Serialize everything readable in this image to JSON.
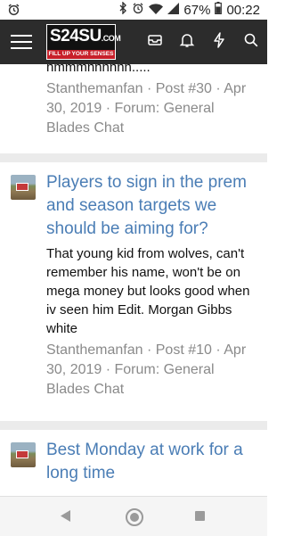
{
  "status_bar": {
    "battery": "67%",
    "time": "00:22",
    "icons": [
      "alarm-icon",
      "bluetooth-icon",
      "alarm-icon",
      "wifi-icon",
      "signal-icon",
      "battery-icon"
    ]
  },
  "app_bar": {
    "logo_text": "S24SU",
    "logo_suffix": ".COM",
    "logo_tagline": "FILL UP YOUR SENSES",
    "icons": [
      "menu-icon",
      "inbox-icon",
      "bell-icon",
      "bolt-icon",
      "search-icon"
    ]
  },
  "results": [
    {
      "snippet_tail": "hmmmnnnnnn.....",
      "author": "Stanthemanfan",
      "post": "Post #30",
      "date": "Apr 30, 2019",
      "forum": "Forum: General Blades Chat"
    },
    {
      "title": "Players to sign in the prem and season targets we should be aiming for?",
      "snippet": "That young kid from wolves, can't remember his name, won't be on mega money but looks good when iv seen him Edit. Morgan Gibbs white",
      "author": "Stanthemanfan",
      "post": "Post #10",
      "date": "Apr 30, 2019",
      "forum": "Forum: General Blades Chat"
    },
    {
      "title": "Best Monday at work for a long time"
    }
  ],
  "meta_separator": " · ",
  "colors": {
    "header_bg": "#2c2c2c",
    "link": "#4a7db5",
    "meta": "#8a8a8a",
    "logo_accent": "#c8202a"
  }
}
